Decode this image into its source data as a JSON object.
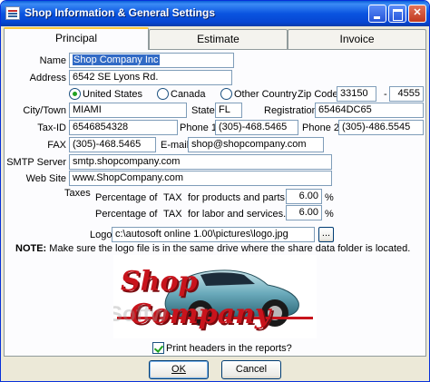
{
  "window": {
    "title": "Shop Information & General Settings"
  },
  "tabs": [
    {
      "label": "Principal",
      "active": true
    },
    {
      "label": "Estimate",
      "active": false
    },
    {
      "label": "Invoice",
      "active": false
    }
  ],
  "form": {
    "name": {
      "label": "Name",
      "value": "Shop Company Inc"
    },
    "address": {
      "label": "Address",
      "value": "6542 SE Lyons Rd."
    },
    "country": {
      "options": [
        "United States",
        "Canada",
        "Other Country"
      ],
      "selected": "United States"
    },
    "zip": {
      "label": "Zip Code",
      "value1": "33150",
      "separator": "-",
      "value2": "4555"
    },
    "city": {
      "label": "City/Town",
      "value": "MIAMI"
    },
    "state": {
      "label": "State",
      "value": "FL"
    },
    "registration": {
      "label": "Registration",
      "value": "65464DC65"
    },
    "tax_id": {
      "label": "Tax-ID",
      "value": "6546854328"
    },
    "phone1": {
      "label": "Phone 1",
      "value": "(305)-468.5465"
    },
    "phone2": {
      "label": "Phone 2",
      "value": "(305)-486.5545"
    },
    "fax": {
      "label": "FAX",
      "value": "(305)-468.5465"
    },
    "email": {
      "label": "E-mail",
      "value": "shop@shopcompany.com"
    },
    "smtp": {
      "label": "SMTP Server",
      "value": "smtp.shopcompany.com"
    },
    "website": {
      "label": "Web Site",
      "value": "www.ShopCompany.com"
    }
  },
  "taxes": {
    "label": "Taxes",
    "rows": [
      {
        "prefix": "Percentage of",
        "tax": "TAX",
        "desc": "for products and parts.",
        "value": "6.00",
        "unit": "%"
      },
      {
        "prefix": "Percentage of",
        "tax": "TAX",
        "desc": "for labor and services.",
        "value": "6.00",
        "unit": "%"
      }
    ]
  },
  "logo": {
    "label": "Logo",
    "path": "c:\\autosoft online 1.00\\pictures\\logo.jpg",
    "browse_label": "...",
    "image_text_line1": "Shop",
    "image_text_line2": "Company",
    "watermark": "Softw"
  },
  "note": {
    "label": "NOTE:",
    "text": "Make sure the logo file is in the same drive where the share data folder is located."
  },
  "print_headers": {
    "label": "Print headers in the reports?",
    "checked": true
  },
  "buttons": {
    "ok": "OK",
    "cancel": "Cancel"
  },
  "colors": {
    "title_bar": "#0a54e0",
    "selection": "#316ac5",
    "active_tab": "#ffc83c",
    "logo_red": "#c8141c"
  }
}
